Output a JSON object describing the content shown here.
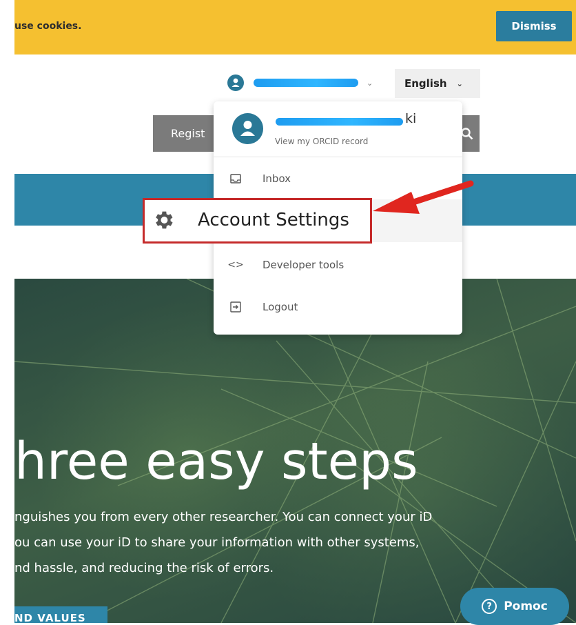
{
  "cookie_banner": {
    "text": "use cookies.",
    "dismiss_label": "Dismiss",
    "bg_color": "#f5c030",
    "button_color": "#2b7d9e"
  },
  "header": {
    "language": "English",
    "register_label": "Regist"
  },
  "user_dropdown": {
    "name_visible_suffix": "ki",
    "subtitle": "View my ORCID record",
    "items": [
      {
        "icon": "inbox-icon",
        "label": "Inbox"
      },
      {
        "icon": "gear-icon",
        "label": "Account Settings"
      },
      {
        "icon": "code-icon",
        "label": "Developer tools"
      },
      {
        "icon": "logout-icon",
        "label": "Logout"
      }
    ]
  },
  "hero": {
    "title": "hree easy steps",
    "body_lines": [
      "nguishes you from every other researcher. You can connect your iD",
      "ou can use your iD to share your information with other systems,",
      "nd hassle, and reducing the risk of errors."
    ],
    "button_label": "ND VALUES"
  },
  "help": {
    "label": "Pomoc"
  },
  "annotation": {
    "highlight_color": "#c52a2a",
    "arrow_color": "#e0261f"
  }
}
